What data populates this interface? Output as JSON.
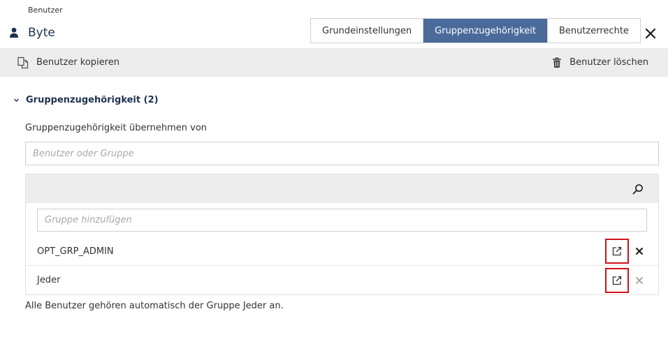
{
  "header": {
    "breadcrumb": "Benutzer",
    "title": "Byte",
    "tabs": [
      {
        "label": "Grundeinstellungen",
        "active": false
      },
      {
        "label": "Gruppenzugehörigkeit",
        "active": true
      },
      {
        "label": "Benutzerrechte",
        "active": false
      }
    ]
  },
  "toolbar": {
    "copy_label": "Benutzer kopieren",
    "delete_label": "Benutzer löschen"
  },
  "section": {
    "title": "Gruppenzugehörigkeit (2)",
    "adopt_label": "Gruppenzugehörigkeit übernehmen von",
    "adopt_placeholder": "Benutzer oder Gruppe",
    "add_placeholder": "Gruppe hinzufügen",
    "groups": [
      {
        "name": "OPT_GRP_ADMIN"
      },
      {
        "name": "Jeder"
      }
    ],
    "footnote": "Alle Benutzer gehören automatisch der Gruppe Jeder an."
  },
  "colors": {
    "accent": "#4a6a9a",
    "title": "#1f3350",
    "toolbar_bg": "#ededee",
    "highlight": "#d0121b"
  }
}
